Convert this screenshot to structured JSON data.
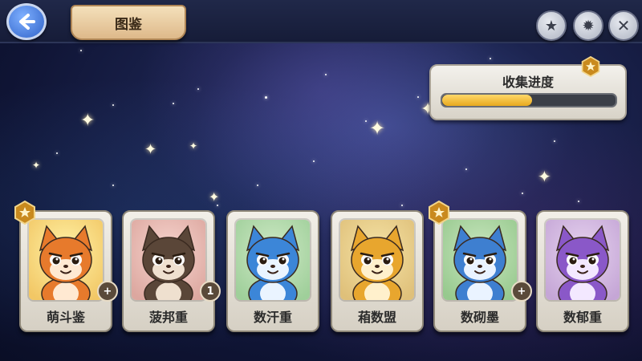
{
  "header": {
    "title": "图鉴"
  },
  "progress": {
    "title": "收集进度",
    "fill_fraction": 0.52
  },
  "colors": {
    "accent_gold": "#e8a91f",
    "panel": "#f3f1ec",
    "night_sky": "#1c2450"
  },
  "icons": [
    "back-arrow-icon",
    "star-icon",
    "gear-icon",
    "close-icon",
    "hexagon-star-badge-icon",
    "plus-icon"
  ],
  "cards": [
    {
      "name": "萌斗鉴",
      "corner": "+",
      "starred": true
    },
    {
      "name": "菠邦重",
      "corner": "1",
      "starred": false
    },
    {
      "name": "数汗重",
      "corner": "",
      "starred": false
    },
    {
      "name": "葙数盟",
      "corner": "",
      "starred": false
    },
    {
      "name": "数砌墨",
      "corner": "+",
      "starred": true
    },
    {
      "name": "数郁重",
      "corner": "",
      "starred": false
    }
  ]
}
